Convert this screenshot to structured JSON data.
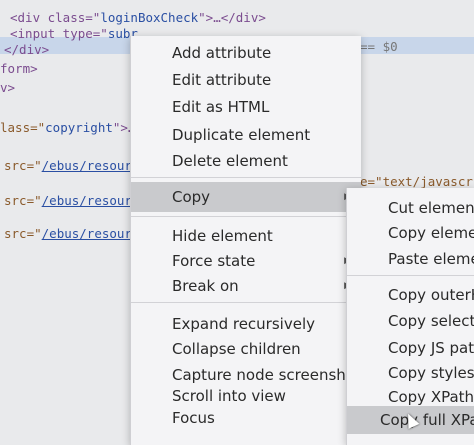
{
  "code_lines": [
    {
      "a": "<div class=\"",
      "b": "loginBoxCheck",
      "c": "\">…</div>"
    },
    {
      "a": "<input type=\"",
      "b": "subr",
      "c": ""
    },
    {
      "a": "</div>",
      "b": "",
      "c": ""
    },
    {
      "a": "form>",
      "b": "",
      "c": ""
    },
    {
      "a": "v>",
      "b": "",
      "c": ""
    },
    {
      "a": "lass=\"",
      "b": "copyright",
      "c": "\">…"
    },
    {
      "a": "src=\"",
      "b": "/ebus/resour",
      "c": ""
    },
    {
      "a": "src=\"",
      "b": "/ebus/resour",
      "c": ""
    },
    {
      "a": "src=\"",
      "b": "/ebus/resour",
      "c": ""
    }
  ],
  "right_code": {
    "selected_suffix": "== $0",
    "type_attr": "e=\"text/javascr"
  },
  "context_menu": {
    "items": [
      {
        "label": "Add attribute"
      },
      {
        "label": "Edit attribute"
      },
      {
        "label": "Edit as HTML"
      },
      {
        "label": "Duplicate element"
      },
      {
        "label": "Delete element"
      },
      {
        "label": "Copy",
        "submenu": true,
        "active": true
      },
      {
        "label": "Hide element"
      },
      {
        "label": "Force state",
        "submenu": true
      },
      {
        "label": "Break on",
        "submenu": true
      },
      {
        "label": "Expand recursively"
      },
      {
        "label": "Collapse children"
      },
      {
        "label": "Capture node screenshot"
      },
      {
        "label": "Scroll into view"
      },
      {
        "label": "Focus"
      }
    ]
  },
  "copy_submenu": {
    "items": [
      {
        "label": "Cut element"
      },
      {
        "label": "Copy elemer"
      },
      {
        "label": "Paste elemer"
      },
      {
        "label": "Copy outerHT"
      },
      {
        "label": "Copy selector"
      },
      {
        "label": "Copy JS path"
      },
      {
        "label": "Copy styles"
      },
      {
        "label": "Copy XPath"
      },
      {
        "label": "Copy full XPath",
        "active": true
      }
    ]
  }
}
